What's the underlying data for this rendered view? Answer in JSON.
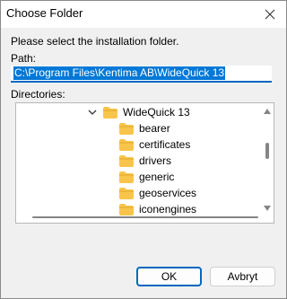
{
  "window": {
    "title": "Choose Folder"
  },
  "instruction": "Please select the installation folder.",
  "path": {
    "label": "Path:",
    "value": "C:\\Program Files\\Kentima AB\\WideQuick 13"
  },
  "directories": {
    "label": "Directories:",
    "parent": {
      "name": "WideQuick 13",
      "expanded": true
    },
    "children": [
      "bearer",
      "certificates",
      "drivers",
      "generic",
      "geoservices",
      "iconengines"
    ]
  },
  "buttons": {
    "ok": "OK",
    "cancel": "Avbryt"
  },
  "colors": {
    "accent": "#0067c0",
    "selection": "#0078d7",
    "folder": "#f8c54a"
  }
}
